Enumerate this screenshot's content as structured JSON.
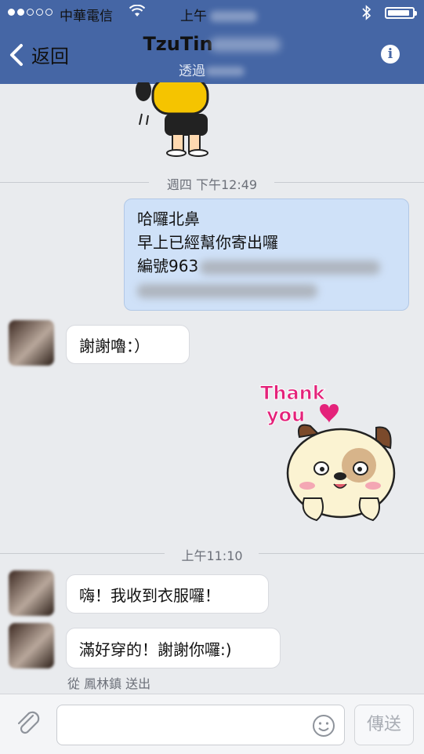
{
  "status_bar": {
    "carrier": "中華電信",
    "time": "上午",
    "signal_dots_filled": 2,
    "signal_dots_total": 5,
    "battery_level": 0.9
  },
  "nav": {
    "back_label": "返回",
    "title": "TzuTin",
    "subtitle": "透過",
    "accent": "#4566a5"
  },
  "messages": {
    "sep1": "週四 下午12:49",
    "outgoing_lines": [
      "哈囉北鼻",
      "早上已經幫你寄出囉",
      "編號963"
    ],
    "incoming1": "謝謝嚕：）",
    "sticker_text_1": "Thank",
    "sticker_text_2": "you",
    "sep2": "上午11:10",
    "incoming2": "嗨！我收到衣服囉！",
    "incoming3": "滿好穿的！謝謝你囉:)",
    "sent_from": "從 鳳林鎮 送出"
  },
  "composer": {
    "placeholder": "",
    "send_label": "傳送"
  },
  "icons": [
    "back-chevron-icon",
    "info-icon",
    "wifi-icon",
    "bluetooth-icon",
    "paperclip-icon",
    "smiley-icon"
  ]
}
